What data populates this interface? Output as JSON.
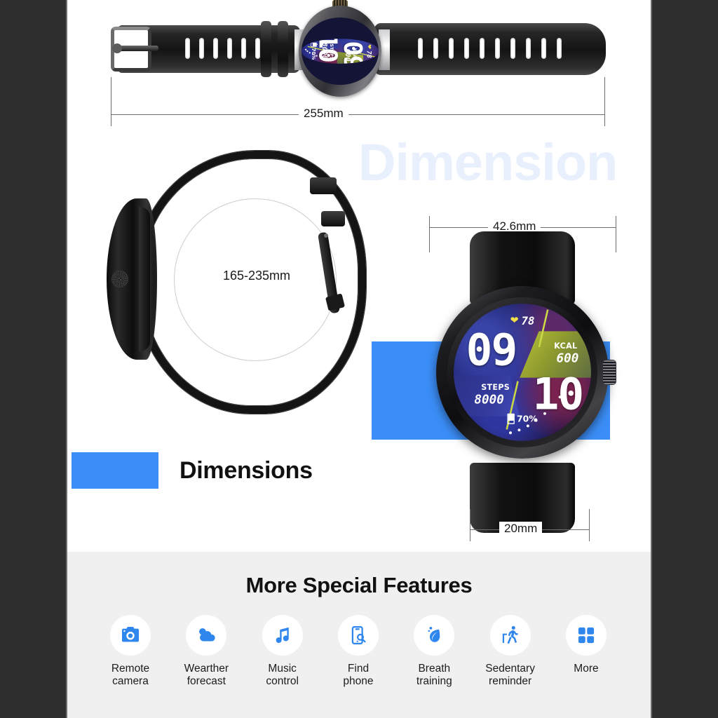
{
  "page": {
    "watermark": "Dimension",
    "accent_blue": "#3b8ef8",
    "background": "#ffffff",
    "letterbox": "#2e2e2e",
    "features_background": "#f0f0f0"
  },
  "dimensions": {
    "overall_length": "255mm",
    "strap_circumference": "165-235mm",
    "case_diameter": "42.6mm",
    "strap_width": "20mm",
    "heading": "Dimensions"
  },
  "watch_face": {
    "heart_icon": "heart-icon",
    "heart_rate": "78",
    "hour": "09",
    "minute": "10",
    "kcal_label": "KCAL",
    "kcal_value": "600",
    "steps_label": "STEPS",
    "steps_value": "8000",
    "battery_icon": "battery-icon",
    "battery_value": "70%"
  },
  "features": {
    "title": "More Special Features",
    "items": [
      {
        "icon": "camera-icon",
        "line1": "Remote",
        "line2": "camera"
      },
      {
        "icon": "cloud-icon",
        "line1": "Wearther",
        "line2": "forecast"
      },
      {
        "icon": "music-note-icon",
        "line1": "Music",
        "line2": "control"
      },
      {
        "icon": "phone-search-icon",
        "line1": "Find",
        "line2": "phone"
      },
      {
        "icon": "leaf-drop-icon",
        "line1": "Breath",
        "line2": "training"
      },
      {
        "icon": "walking-person-icon",
        "line1": "Sedentary",
        "line2": "reminder"
      },
      {
        "icon": "grid-squares-icon",
        "line1": "More",
        "line2": ""
      }
    ]
  }
}
